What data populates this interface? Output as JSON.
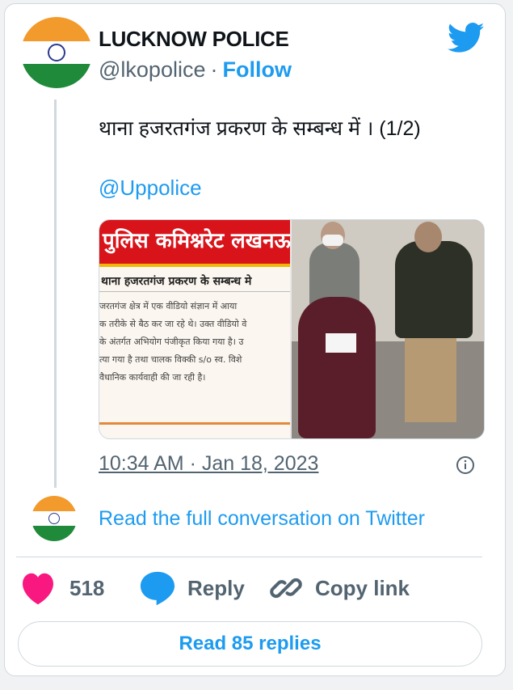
{
  "author": {
    "name": "LUCKNOW POLICE",
    "handle": "@lkopolice",
    "separator": "·",
    "follow_label": "Follow"
  },
  "tweet": {
    "text": "थाना हजरतगंज प्रकरण के सम्बन्ध में । (1/2)",
    "mention": "@Uppolice",
    "timestamp": "10:34 AM · Jan 18, 2023"
  },
  "media": {
    "left_image": {
      "banner": "पुलिस कमिश्नरेट लखनऊ",
      "subhead": "थाना हजरतगंज प्रकरण  के सम्बन्ध मे",
      "lines": [
        "जरतगंज क्षेत्र में एक वीडियो संज्ञान में आया",
        "क तरीके से बैठ कर जा रहे थे। उक्त वीडियो वे",
        "के अंतर्गत अभियोग पंजीकृत किया गया है। उ",
        "त्या गया है तथा चालक विक्की s/o स्व. विशे",
        "वैधानिक कार्यवाही की जा रही है।"
      ]
    }
  },
  "conversation": {
    "read_full": "Read the full conversation on Twitter"
  },
  "actions": {
    "like_count": "518",
    "reply_label": "Reply",
    "copy_label": "Copy link"
  },
  "replies_button": "Read 85 replies",
  "colors": {
    "accent": "#1d9bf0",
    "like": "#f91880",
    "secondary_text": "#536471",
    "border": "#cfd9de"
  },
  "icons": [
    "twitter-bird-icon",
    "info-icon",
    "heart-icon",
    "speech-bubble-icon",
    "link-icon"
  ]
}
